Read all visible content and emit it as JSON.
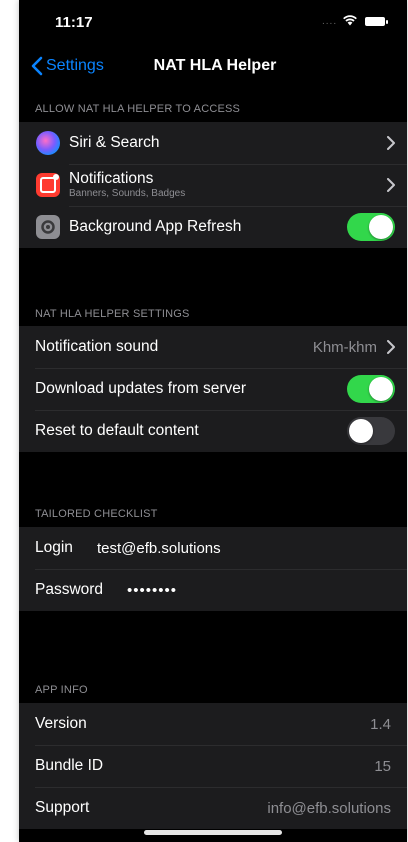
{
  "status_bar": {
    "time": "11:17",
    "signal": "....",
    "wifi_icon": "wifi-icon",
    "battery_icon": "battery-icon"
  },
  "nav": {
    "back_label": "Settings",
    "title": "NAT HLA Helper"
  },
  "sections": {
    "access": {
      "header": "ALLOW NAT HLA HELPER TO ACCESS",
      "items": [
        {
          "label": "Siri & Search",
          "icon": "siri-icon"
        },
        {
          "label": "Notifications",
          "sublabel": "Banners, Sounds, Badges",
          "icon": "notifications-icon"
        },
        {
          "label": "Background App Refresh",
          "icon": "gear-icon",
          "toggle": true
        }
      ]
    },
    "settings": {
      "header": "NAT HLA HELPER SETTINGS",
      "items": [
        {
          "label": "Notification sound",
          "value": "Khm-khm"
        },
        {
          "label": "Download updates from server",
          "toggle": true
        },
        {
          "label": "Reset to default content",
          "toggle": false
        }
      ]
    },
    "checklist": {
      "header": "TAILORED CHECKLIST",
      "login_label": "Login",
      "login_value": "test@efb.solutions",
      "password_label": "Password",
      "password_value": "••••••••"
    },
    "app_info": {
      "header": "APP INFO",
      "items": [
        {
          "label": "Version",
          "value": "1.4"
        },
        {
          "label": "Bundle ID",
          "value": "15"
        },
        {
          "label": "Support",
          "value": "info@efb.solutions"
        }
      ]
    }
  },
  "colors": {
    "accent": "#0a84ff",
    "toggle_on": "#32d74b",
    "notifications_red": "#ff3b30",
    "settings_gray": "#8e8e93"
  }
}
